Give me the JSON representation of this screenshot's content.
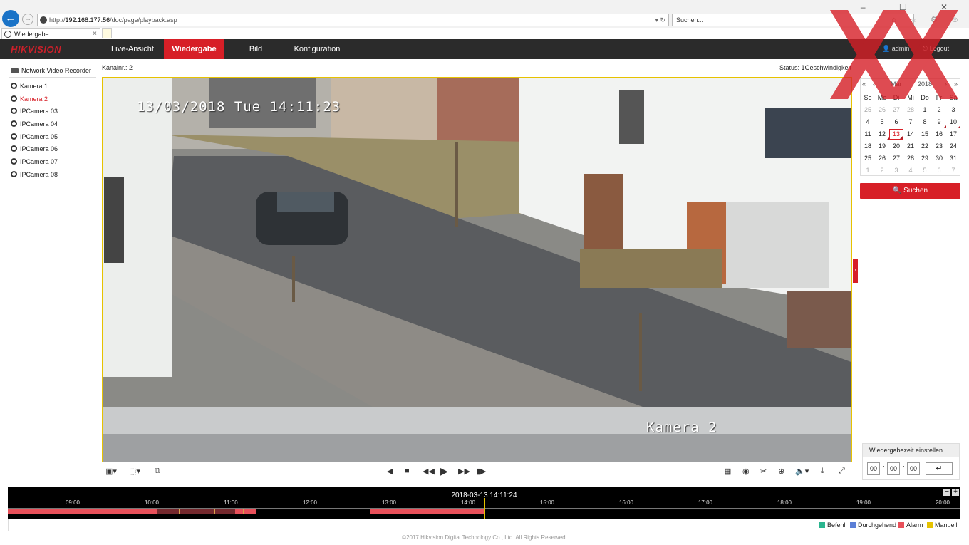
{
  "browser": {
    "url_prefix": "http://",
    "url_host": "192.168.177.56",
    "url_path": "/doc/page/playback.asp",
    "search_placeholder": "Suchen...",
    "tab_title": "Wiedergabe",
    "tab_close": "×",
    "addr_controls": "▾ ↻",
    "window_controls": "– ☐ ✕",
    "toolbar_icons": "⌂ ☆ ⚙ ☺"
  },
  "nav": {
    "logo": "HIKVISION",
    "tabs": [
      {
        "label": "Live-Ansicht"
      },
      {
        "label": "Wiedergabe"
      },
      {
        "label": "Bild"
      },
      {
        "label": "Konfiguration"
      }
    ],
    "user": "admin",
    "logout": "Logout"
  },
  "sidebar": {
    "device": "Network Video Recorder",
    "cameras": [
      {
        "label": "Kamera 1"
      },
      {
        "label": "Kamera 2"
      },
      {
        "label": "IPCamera 03"
      },
      {
        "label": "IPCamera 04"
      },
      {
        "label": "IPCamera 05"
      },
      {
        "label": "IPCamera 06"
      },
      {
        "label": "IPCamera 07"
      },
      {
        "label": "IPCamera 08"
      }
    ]
  },
  "video": {
    "channel": "Kanalnr.: 2",
    "status": "Status: 1Geschwindigkeit",
    "osd_datetime": "13/03/2018 Tue 14:11:23",
    "osd_camera": "Kamera 2"
  },
  "calendar": {
    "month": "Mär",
    "year": "2018",
    "weekdays": [
      "So",
      "Mo",
      "Di",
      "Mi",
      "Do",
      "Fr",
      "Sa"
    ],
    "weeks": [
      [
        "25",
        "26",
        "27",
        "28",
        "1",
        "2",
        "3"
      ],
      [
        "4",
        "5",
        "6",
        "7",
        "8",
        "9",
        "10"
      ],
      [
        "11",
        "12",
        "13",
        "14",
        "15",
        "16",
        "17"
      ],
      [
        "18",
        "19",
        "20",
        "21",
        "22",
        "23",
        "24"
      ],
      [
        "25",
        "26",
        "27",
        "28",
        "29",
        "30",
        "31"
      ],
      [
        "1",
        "2",
        "3",
        "4",
        "5",
        "6",
        "7"
      ]
    ],
    "search_label": "Suchen"
  },
  "playback_time": {
    "title": "Wiedergabezeit einstellen",
    "hh": "00",
    "mm": "00",
    "ss": "00",
    "sep": ":",
    "go": "↵"
  },
  "timeline": {
    "current": "2018-03-13 14:11:24",
    "hours": [
      "09:00",
      "10:00",
      "11:00",
      "12:00",
      "13:00",
      "14:00",
      "15:00",
      "16:00",
      "17:00",
      "18:00",
      "19:00",
      "20:00"
    ],
    "zoom_out": "−",
    "zoom_in": "+"
  },
  "legend": [
    {
      "label": "Befehl",
      "color": "#2bb58f"
    },
    {
      "label": "Durchgehend",
      "color": "#5b7fd6"
    },
    {
      "label": "Alarm",
      "color": "#e8505a"
    },
    {
      "label": "Manuell",
      "color": "#e6c200"
    }
  ],
  "footer": "©2017 Hikvision Digital Technology Co., Ltd. All Rights Reserved.",
  "colors": {
    "accent": "#d71f27",
    "nav_bg": "#2b2b2b",
    "selection": "#e6c200"
  }
}
